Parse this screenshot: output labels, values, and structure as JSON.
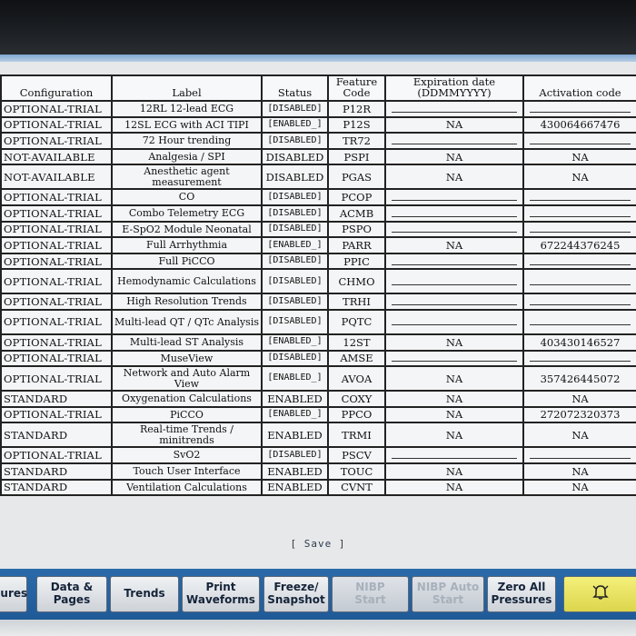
{
  "table": {
    "headers": {
      "configuration": "Configuration",
      "label": "Label",
      "status": "Status",
      "feature_code": "Feature\nCode",
      "expiration_date": "Expiration date\n(DDMMYYYY)",
      "activation_code": "Activation code"
    },
    "rows": [
      {
        "configuration": "OPTIONAL-TRIAL",
        "label": "12RL 12-lead ECG",
        "status": "[DISABLED]",
        "code": "P12R",
        "expiration": "",
        "activation": ""
      },
      {
        "configuration": "OPTIONAL-TRIAL",
        "label": "12SL ECG with ACI TIPI",
        "status": "[ENABLED_]",
        "code": "P12S",
        "expiration": "NA",
        "activation": "430064667476"
      },
      {
        "configuration": "OPTIONAL-TRIAL",
        "label": "72 Hour trending",
        "status": "[DISABLED]",
        "code": "TR72",
        "expiration": "",
        "activation": ""
      },
      {
        "configuration": "NOT-AVAILABLE",
        "label": "Analgesia / SPI",
        "status": "DISABLED",
        "code": "PSPI",
        "expiration": "NA",
        "activation": "NA"
      },
      {
        "configuration": "NOT-AVAILABLE",
        "label": "Anesthetic agent measurement",
        "status": "DISABLED",
        "code": "PGAS",
        "expiration": "NA",
        "activation": "NA"
      },
      {
        "configuration": "OPTIONAL-TRIAL",
        "label": "CO",
        "status": "[DISABLED]",
        "code": "PCOP",
        "expiration": "",
        "activation": ""
      },
      {
        "configuration": "OPTIONAL-TRIAL",
        "label": "Combo Telemetry ECG",
        "status": "[DISABLED]",
        "code": "ACMB",
        "expiration": "",
        "activation": ""
      },
      {
        "configuration": "OPTIONAL-TRIAL",
        "label": "E-SpO2 Module Neonatal",
        "status": "[DISABLED]",
        "code": "PSPO",
        "expiration": "",
        "activation": ""
      },
      {
        "configuration": "OPTIONAL-TRIAL",
        "label": "Full Arrhythmia",
        "status": "[ENABLED_]",
        "code": "PARR",
        "expiration": "NA",
        "activation": "672244376245"
      },
      {
        "configuration": "OPTIONAL-TRIAL",
        "label": "Full PiCCO",
        "status": "[DISABLED]",
        "code": "PPIC",
        "expiration": "",
        "activation": ""
      },
      {
        "configuration": "OPTIONAL-TRIAL",
        "label": "Hemodynamic Calculations",
        "status": "[DISABLED]",
        "code": "CHMO",
        "expiration": "",
        "activation": ""
      },
      {
        "configuration": "OPTIONAL-TRIAL",
        "label": "High Resolution Trends",
        "status": "[DISABLED]",
        "code": "TRHI",
        "expiration": "",
        "activation": ""
      },
      {
        "configuration": "OPTIONAL-TRIAL",
        "label": "Multi-lead QT / QTc Analysis",
        "status": "[DISABLED]",
        "code": "PQTC",
        "expiration": "",
        "activation": ""
      },
      {
        "configuration": "OPTIONAL-TRIAL",
        "label": "Multi-lead ST Analysis",
        "status": "[ENABLED_]",
        "code": "12ST",
        "expiration": "NA",
        "activation": "403430146527"
      },
      {
        "configuration": "OPTIONAL-TRIAL",
        "label": "MuseView",
        "status": "[DISABLED]",
        "code": "AMSE",
        "expiration": "",
        "activation": ""
      },
      {
        "configuration": "OPTIONAL-TRIAL",
        "label": "Network and Auto Alarm View",
        "status": "[ENABLED_]",
        "code": "AVOA",
        "expiration": "NA",
        "activation": "357426445072"
      },
      {
        "configuration": "STANDARD",
        "label": "Oxygenation Calculations",
        "status": "ENABLED",
        "code": "COXY",
        "expiration": "NA",
        "activation": "NA"
      },
      {
        "configuration": "OPTIONAL-TRIAL",
        "label": "PiCCO",
        "status": "[ENABLED_]",
        "code": "PPCO",
        "expiration": "NA",
        "activation": "272072320373"
      },
      {
        "configuration": "STANDARD",
        "label": "Real-time Trends / minitrends",
        "status": "ENABLED",
        "code": "TRMI",
        "expiration": "NA",
        "activation": "NA"
      },
      {
        "configuration": "OPTIONAL-TRIAL",
        "label": "SvO2",
        "status": "[DISABLED]",
        "code": "PSCV",
        "expiration": "",
        "activation": ""
      },
      {
        "configuration": "STANDARD",
        "label": "Touch User Interface",
        "status": "ENABLED",
        "code": "TOUC",
        "expiration": "NA",
        "activation": "NA"
      },
      {
        "configuration": "STANDARD",
        "label": "Ventilation Calculations",
        "status": "ENABLED",
        "code": "CVNT",
        "expiration": "NA",
        "activation": "NA"
      }
    ]
  },
  "save_label": "[ Save ]",
  "softkeys": [
    {
      "name": "softkey-procedures",
      "label": "dures",
      "disabled": false
    },
    {
      "name": "softkey-data-pages",
      "label": "Data &\nPages",
      "disabled": false
    },
    {
      "name": "softkey-trends",
      "label": "Trends",
      "disabled": false
    },
    {
      "name": "softkey-print-waveforms",
      "label": "Print\nWaveforms",
      "disabled": false
    },
    {
      "name": "softkey-freeze-snapshot",
      "label": "Freeze/\nSnapshot",
      "disabled": false
    },
    {
      "name": "softkey-nibp-start",
      "label": "NIBP\nStart",
      "disabled": true
    },
    {
      "name": "softkey-nibp-auto-start",
      "label": "NIBP Auto\nStart",
      "disabled": true
    },
    {
      "name": "softkey-zero-all-pressures",
      "label": "Zero All\nPressures",
      "disabled": false
    },
    {
      "name": "softkey-alarm-silence",
      "label": "",
      "icon": "alarm-bell-icon",
      "disabled": false
    }
  ],
  "colors": {
    "softkey_bar": "#2b6aa9",
    "alarm_key": "#f4f07a",
    "disabled_text": "#a8b0ba"
  }
}
